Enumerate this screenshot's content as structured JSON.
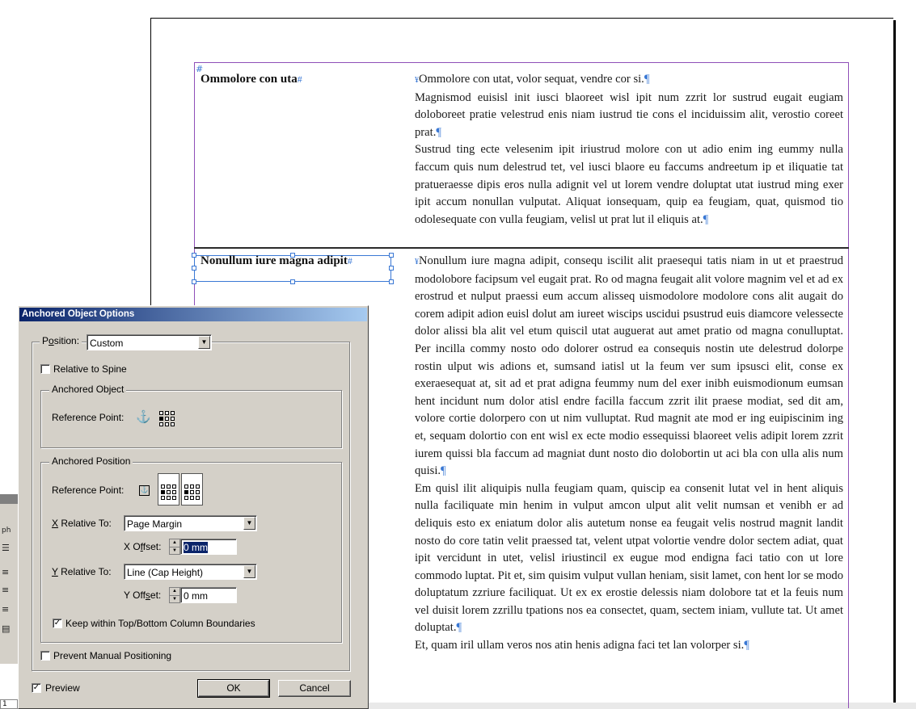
{
  "document": {
    "heading1": "Ommolore con uta",
    "heading2": "Nonullum iure magna adipit",
    "hash_mark": "#",
    "pilcrow": "¶",
    "col1_paragraphs": [
      "Ommolore con utat, volor sequat, vendre cor si.",
      "Magnismod euisisl init iusci blaoreet wisl ipit num zzrit lor sustrud eugait eugiam doloboreet pratie velestrud enis niam iustrud tie cons el inciduis­sim alit, verostio coreet prat.",
      "Sustrud ting ecte velesenim ipit iriustrud molore con ut adio enim ing eummy nulla faccum quis num delestrud tet, vel iusci blaore eu faccums andreetum ip et iliquatie tat pratueraesse dipis eros nulla adignit vel ut lorem vendre doluptat utat iustrud ming exer ipit accum nonullan vulputat. Aliquat ionsequam, quip ea feugiam, quat, quismod tio odolesequate con vulla feugiam, velisl ut prat lut il eliquis at."
    ],
    "col2_paragraphs": [
      "Nonullum iure magna adipit, consequ iscilit alit praesequi tatis niam in ut et praestrud modolobore facipsum vel eugait prat. Ro od magna feugait alit volore magnim vel et ad ex erostrud et nulput praessi eum accum alisseq uismodolore modolore cons alit augait do corem adipit adion euisl dolut am iureet wiscips uscidui psustrud euis diamcore velessecte dolor alissi bla alit vel etum quiscil utat auguerat aut amet pratio od magna conul­luptat. Per incilla commy nosto odo dolorer ostrud ea consequis nostin ute delestrud dolorpe rostin ulput wis adions et, sumsand iatisl ut la feum ver sum ipsusci elit, conse ex exeraesequat at, sit ad et prat adigna feummy num del exer inibh euismodionum eumsan hent incidunt num dolor atisl endre facilla faccum zzrit ilit praese modiat, sed dit am, volore cortie do­lorpero con ut nim vulluptat. Rud magnit ate mod er ing euipiscinim ing et, sequam dolortio con ent wisl ex ecte modio essequissi blaoreet velis adipit lorem zzrit iurem quissi bla faccum ad magniat dunt nosto dio dolo­bortin ut aci bla con ulla alis num quisi.",
      "Em quisl ilit aliquipis nulla feugiam quam, quiscip ea consenit lutat vel in hent aliquis nulla faciliquate min henim in vulput amcon ulput alit velit numsan et venibh er ad deliquis esto ex eniatum dolor alis autetum nonse ea feugait velis nostrud magnit landit nosto do core tatin velit praessed tat, velent utpat volortie vendre dolor sectem adiat, quat ipit vercidunt in utet, velisl iriustincil ex eugue mod endigna faci tatio con ut lore commodo luptat. Pit et, sim quisim vulput vullan heniam, sisit lamet, con hent lor se modo doluptatum zzriure faciliquat. Ut ex ex erostie delessis niam dolo­bore tat et la feuis num vel duisit lorem zzrillu tpations nos ea consectet, quam, sectem iniam, vullute tat. Ut amet doluptat.",
      "Et, quam iril ullam veros nos atin henis adigna faci tet lan volorper si."
    ]
  },
  "dialog": {
    "title": "Anchored Object Options",
    "position_label": "Position:",
    "position_value": "Custom",
    "relative_to_spine": "Relative to Spine",
    "relative_to_spine_checked": false,
    "anchored_object_legend": "Anchored Object",
    "reference_point_label": "Reference Point:",
    "anchored_position_legend": "Anchored Position",
    "x_relative_label": "X Relative To:",
    "x_relative_value": "Page Margin",
    "x_offset_label": "X Offset:",
    "x_offset_value": "0 mm",
    "y_relative_label": "Y Relative To:",
    "y_relative_value": "Line (Cap Height)",
    "y_offset_label": "Y Offset:",
    "y_offset_value": "0 mm",
    "keep_within": "Keep within Top/Bottom Column Boundaries",
    "keep_within_checked": true,
    "prevent_manual": "Prevent Manual Positioning",
    "prevent_manual_checked": false,
    "preview": "Preview",
    "preview_checked": true,
    "ok": "OK",
    "cancel": "Cancel"
  },
  "fragment_panel": {
    "label_ph": "ph",
    "page_number": "1"
  },
  "colors": {
    "frame_purple": "#8f4fb8",
    "selection_blue": "#3a78d4",
    "titlebar_start": "#0a246a",
    "titlebar_end": "#a6caf0"
  }
}
